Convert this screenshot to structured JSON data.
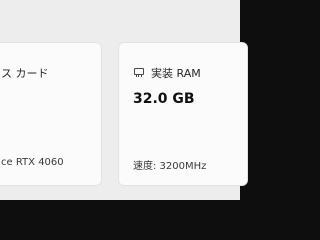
{
  "gpu_card": {
    "title": "ス カード",
    "detail": "ce RTX 4060"
  },
  "ram_card": {
    "icon": "ram-icon",
    "title": "実装 RAM",
    "value": "32.0 GB",
    "detail": "速度: 3200MHz"
  }
}
